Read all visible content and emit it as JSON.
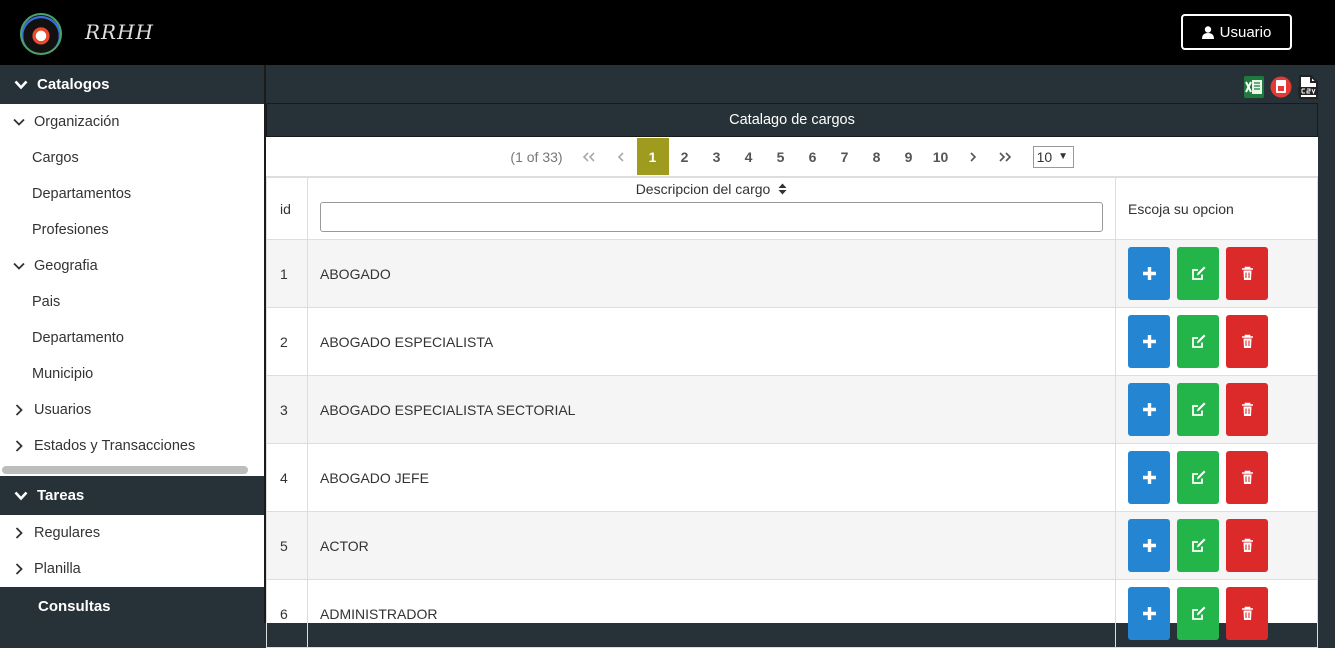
{
  "header": {
    "brand": "RRHH",
    "user_label": "Usuario"
  },
  "sidebar": {
    "sections": [
      {
        "label": "Catalogos",
        "items": [
          {
            "type": "group",
            "label": "Organización",
            "expanded": true
          },
          {
            "type": "leaf",
            "label": "Cargos"
          },
          {
            "type": "leaf",
            "label": "Departamentos"
          },
          {
            "type": "leaf",
            "label": "Profesiones"
          },
          {
            "type": "group",
            "label": "Geografia",
            "expanded": true
          },
          {
            "type": "leaf",
            "label": "Pais"
          },
          {
            "type": "leaf",
            "label": "Departamento"
          },
          {
            "type": "leaf",
            "label": "Municipio"
          },
          {
            "type": "group",
            "label": "Usuarios",
            "expanded": false
          },
          {
            "type": "group",
            "label": "Estados y Transacciones",
            "expanded": false
          }
        ]
      },
      {
        "label": "Tareas",
        "items": [
          {
            "type": "group",
            "label": "Regulares",
            "expanded": false
          },
          {
            "type": "group",
            "label": "Planilla",
            "expanded": false
          }
        ]
      },
      {
        "label": "Consultas",
        "items": []
      }
    ]
  },
  "export_icons": [
    "excel-icon",
    "pdf-icon",
    "csv-icon"
  ],
  "panel": {
    "title": "Catalago de cargos",
    "pager": {
      "info": "(1 of 33)",
      "pages": [
        "1",
        "2",
        "3",
        "4",
        "5",
        "6",
        "7",
        "8",
        "9",
        "10"
      ],
      "current": "1",
      "rows_per_page": "10"
    },
    "columns": {
      "id": "id",
      "desc": "Descripcion del cargo",
      "options": "Escoja su opcion"
    },
    "rows": [
      {
        "id": "1",
        "desc": "ABOGADO"
      },
      {
        "id": "2",
        "desc": "ABOGADO ESPECIALISTA"
      },
      {
        "id": "3",
        "desc": "ABOGADO ESPECIALISTA SECTORIAL"
      },
      {
        "id": "4",
        "desc": "ABOGADO JEFE"
      },
      {
        "id": "5",
        "desc": "ACTOR"
      },
      {
        "id": "6",
        "desc": "ADMINISTRADOR"
      }
    ]
  },
  "colors": {
    "active_page": "#9e9b1f",
    "add": "#2486d3",
    "edit": "#23b44a",
    "delete": "#dc2a2a",
    "sidebar_bg": "#263238"
  }
}
